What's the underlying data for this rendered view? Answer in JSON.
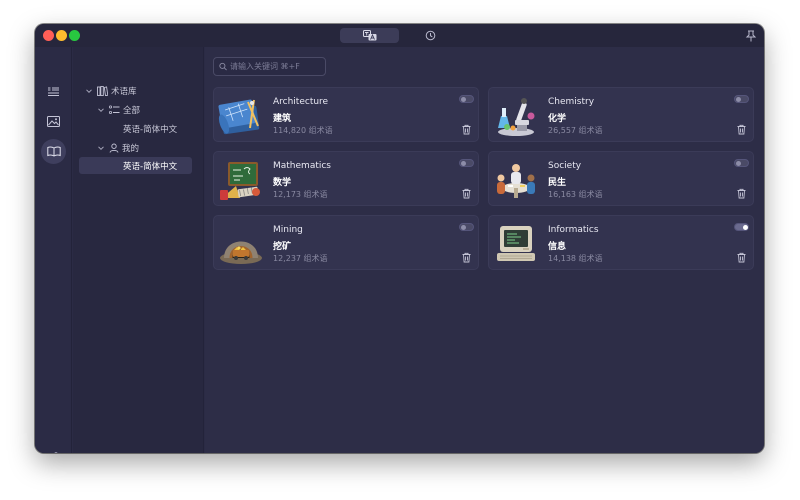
{
  "sidebar": {
    "library_label": "术语库",
    "all_label": "全部",
    "all_child": "英语-简体中文",
    "mine_label": "我的",
    "mine_child": "英语-简体中文"
  },
  "search": {
    "placeholder": "请输入关键词 ⌘+F"
  },
  "cards": [
    {
      "name": "Architecture",
      "zh": "建筑",
      "count": "114,820 组术语",
      "enabled": false,
      "icon": "blueprint-icon"
    },
    {
      "name": "Chemistry",
      "zh": "化学",
      "count": "26,557 组术语",
      "enabled": false,
      "icon": "microscope-icon"
    },
    {
      "name": "Mathematics",
      "zh": "数学",
      "count": "12,173 组术语",
      "enabled": false,
      "icon": "chalkboard-icon"
    },
    {
      "name": "Society",
      "zh": "民生",
      "count": "16,163 组术语",
      "enabled": false,
      "icon": "people-table-icon"
    },
    {
      "name": "Mining",
      "zh": "挖矿",
      "count": "12,237 组术语",
      "enabled": false,
      "icon": "mine-cart-icon"
    },
    {
      "name": "Informatics",
      "zh": "信息",
      "count": "14,138 组术语",
      "enabled": true,
      "icon": "computer-icon"
    }
  ],
  "colors": {
    "window_bg": "#2b2b45",
    "card_bg": "#33334f",
    "accent": "#3f3f5e"
  }
}
